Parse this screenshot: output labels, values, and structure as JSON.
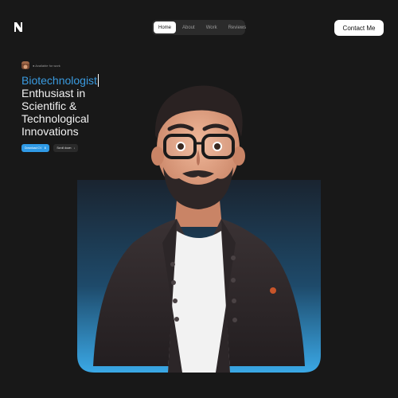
{
  "nav": {
    "items": [
      {
        "label": "Home",
        "active": true
      },
      {
        "label": "About",
        "active": false
      },
      {
        "label": "Work",
        "active": false
      },
      {
        "label": "Reviews",
        "active": false
      }
    ]
  },
  "contact_label": "Contact Me",
  "hero": {
    "availability": "● Available for work",
    "accent_word": "Biotechnologist",
    "rest_lines": [
      "Enthusiast in",
      "Scientific &",
      "Technological",
      "Innovations"
    ]
  },
  "buttons": {
    "download_label": "Download CV",
    "download_icon": "⬇",
    "secondary_label": "Scroll down",
    "secondary_icon": "↓"
  },
  "colors": {
    "accent": "#3a9be0",
    "background": "#181818",
    "card_gradient_top": "#1a2a38",
    "card_gradient_bottom": "#3aa8e6"
  }
}
